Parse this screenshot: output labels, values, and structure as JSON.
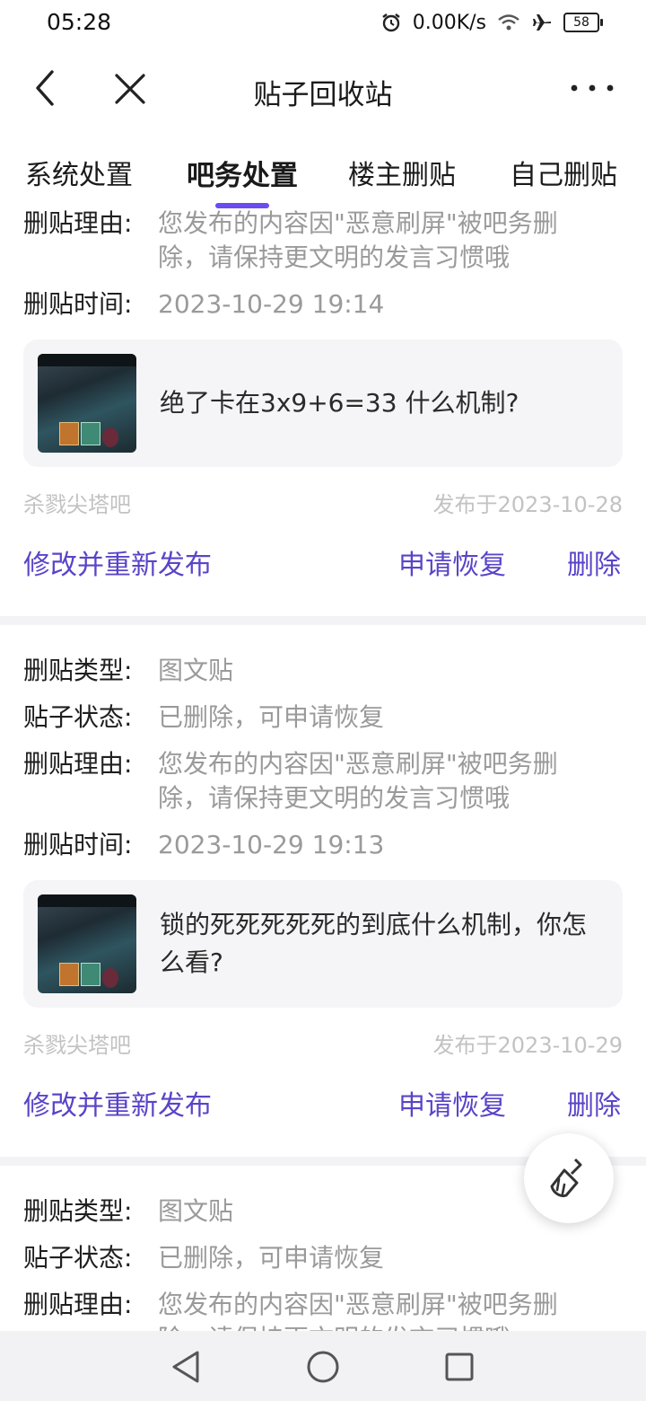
{
  "status_bar": {
    "time": "05:28",
    "network_speed": "0.00K/s",
    "battery": "58",
    "icons": [
      "alarm-icon",
      "wifi-icon",
      "airplane-icon",
      "battery-icon"
    ]
  },
  "nav": {
    "title": "贴子回收站",
    "icons": [
      "back-icon",
      "close-icon",
      "more-icon"
    ]
  },
  "tabs": [
    {
      "label": "系统处置",
      "active": false
    },
    {
      "label": "吧务处置",
      "active": true
    },
    {
      "label": "楼主删贴",
      "active": false
    },
    {
      "label": "自己删贴",
      "active": false
    }
  ],
  "labels": {
    "type": "删贴类型:",
    "status": "贴子状态:",
    "reason": "删贴理由:",
    "time": "删贴时间:"
  },
  "actions": {
    "edit_republish": "修改并重新发布",
    "apply_restore": "申请恢复",
    "delete": "删除"
  },
  "cards": [
    {
      "reason": "您发布的内容因\"恶意刷屏\"被吧务删除，请保持更文明的发言习惯哦",
      "time": "2023-10-29 19:14",
      "post_title": "绝了卡在3x9+6=33 什么机制?",
      "forum": "杀戮尖塔吧",
      "published": "发布于2023-10-28"
    },
    {
      "type": "图文贴",
      "status": "已删除，可申请恢复",
      "reason": "您发布的内容因\"恶意刷屏\"被吧务删除，请保持更文明的发言习惯哦",
      "time": "2023-10-29 19:13",
      "post_title": "锁的死死死死死的到底什么机制，你怎么看?",
      "forum": "杀戮尖塔吧",
      "published": "发布于2023-10-29"
    },
    {
      "type": "图文贴",
      "status": "已删除，可申请恢复",
      "reason": "您发布的内容因\"恶意刷屏\"被吧务删除，请保持更文明的发言习惯哦"
    }
  ],
  "fab_icon": "broom-icon",
  "system_nav": [
    "back-triangle-icon",
    "home-circle-icon",
    "recents-square-icon"
  ],
  "colors": {
    "accent": "#5a44c8",
    "tab_indicator": "#6a4cf0",
    "muted_text": "#9a9a9a",
    "meta_text": "#c2c2c2",
    "post_bg": "#f5f5f7"
  }
}
